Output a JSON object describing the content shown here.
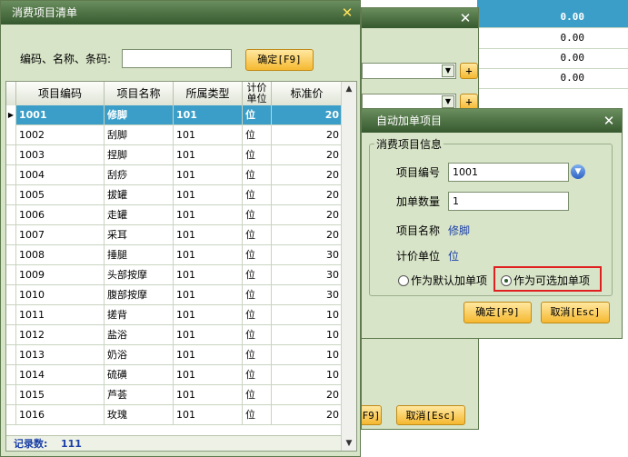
{
  "background": {
    "values": [
      "0.00",
      "0.00",
      "0.00",
      "0.00"
    ],
    "add_btn_1": "+",
    "add_btn_2": "+",
    "btn_ok_partial": "F9]",
    "btn_cancel": "取消[Esc]"
  },
  "list_dialog": {
    "title": "消费项目清单",
    "search_label": "编码、名称、条码:",
    "search_value": "",
    "confirm_btn": "确定[F9]",
    "columns": [
      "项目编码",
      "项目名称",
      "所属类型",
      "计价单位",
      "标准价"
    ],
    "rows": [
      {
        "code": "1001",
        "name": "修脚",
        "type": "101",
        "unit": "位",
        "price": "20",
        "selected": true
      },
      {
        "code": "1002",
        "name": "刮脚",
        "type": "101",
        "unit": "位",
        "price": "20"
      },
      {
        "code": "1003",
        "name": "捏脚",
        "type": "101",
        "unit": "位",
        "price": "20"
      },
      {
        "code": "1004",
        "name": "刮痧",
        "type": "101",
        "unit": "位",
        "price": "20"
      },
      {
        "code": "1005",
        "name": "拔罐",
        "type": "101",
        "unit": "位",
        "price": "20"
      },
      {
        "code": "1006",
        "name": "走罐",
        "type": "101",
        "unit": "位",
        "price": "20"
      },
      {
        "code": "1007",
        "name": "采耳",
        "type": "101",
        "unit": "位",
        "price": "20"
      },
      {
        "code": "1008",
        "name": "捶腿",
        "type": "101",
        "unit": "位",
        "price": "30"
      },
      {
        "code": "1009",
        "name": "头部按摩",
        "type": "101",
        "unit": "位",
        "price": "30"
      },
      {
        "code": "1010",
        "name": "腹部按摩",
        "type": "101",
        "unit": "位",
        "price": "30"
      },
      {
        "code": "1011",
        "name": "搓背",
        "type": "101",
        "unit": "位",
        "price": "10"
      },
      {
        "code": "1012",
        "name": "盐浴",
        "type": "101",
        "unit": "位",
        "price": "10"
      },
      {
        "code": "1013",
        "name": "奶浴",
        "type": "101",
        "unit": "位",
        "price": "10"
      },
      {
        "code": "1014",
        "name": "硫磺",
        "type": "101",
        "unit": "位",
        "price": "10"
      },
      {
        "code": "1015",
        "name": "芦荟",
        "type": "101",
        "unit": "位",
        "price": "20"
      },
      {
        "code": "1016",
        "name": "玫瑰",
        "type": "101",
        "unit": "位",
        "price": "20"
      }
    ],
    "record_count_label": "记录数:",
    "record_count": "111"
  },
  "auto_dialog": {
    "title": "自动加单项目",
    "group_title": "消费项目信息",
    "code_label": "项目编号",
    "code_value": "1001",
    "qty_label": "加单数量",
    "qty_value": "1",
    "name_label": "项目名称",
    "name_value": "修脚",
    "unit_label": "计价单位",
    "unit_value": "位",
    "radio_default": "作为默认加单项",
    "radio_optional": "作为可选加单项",
    "selected_option": "optional",
    "ok_btn": "确定[F9]",
    "cancel_btn": "取消[Esc]"
  },
  "colors": {
    "title_bar": "#36582e",
    "dialog_bg": "#d8e4c8",
    "selected_row": "#3a9ec8",
    "accent_button": "#f5b830",
    "highlight_box": "#e02020",
    "link_text": "#1a3fa8"
  }
}
